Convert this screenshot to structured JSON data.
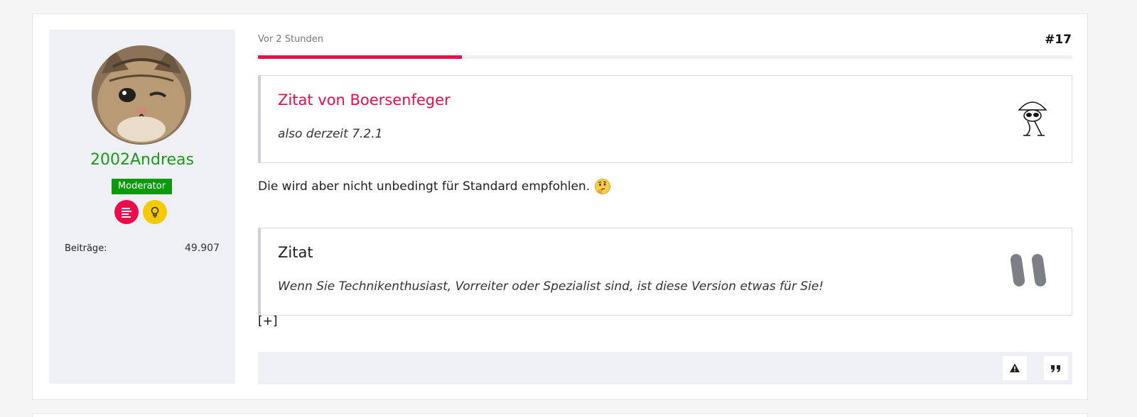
{
  "author": {
    "username": "2002Andreas",
    "role_badge": "Moderator",
    "awards": [
      "list-award-icon",
      "lightbulb-award-icon"
    ],
    "stats": {
      "posts_label": "Beiträge:",
      "posts_value": "49.907"
    },
    "colors": {
      "username": "#1a9a1a",
      "badge_bg": "#0a9a0a"
    }
  },
  "post": {
    "time": "Vor 2 Stunden",
    "number": "#17",
    "progress_fraction": 0.25,
    "quote1": {
      "title": "Zitat von Boersenfeger",
      "text": "also derzeit 7.2.1",
      "icon": "spy-character-avatar"
    },
    "body": "Die wird aber nicht unbedingt für Standard empfohlen.",
    "body_emoji": "thinking-face-icon",
    "quote2": {
      "title": "Zitat",
      "text": "Wenn Sie Technikenthusiast, Vorreiter oder Spezialist sind, ist diese Version etwas für Sie!",
      "icon": "quote-mark-icon"
    },
    "expand_label": "[+]",
    "footer_buttons": [
      "report-icon",
      "quote-icon"
    ]
  },
  "colors": {
    "accent": "#ee0b4b",
    "award_yellow": "#f5cb00",
    "sidebar_bg": "#eef0f6"
  }
}
